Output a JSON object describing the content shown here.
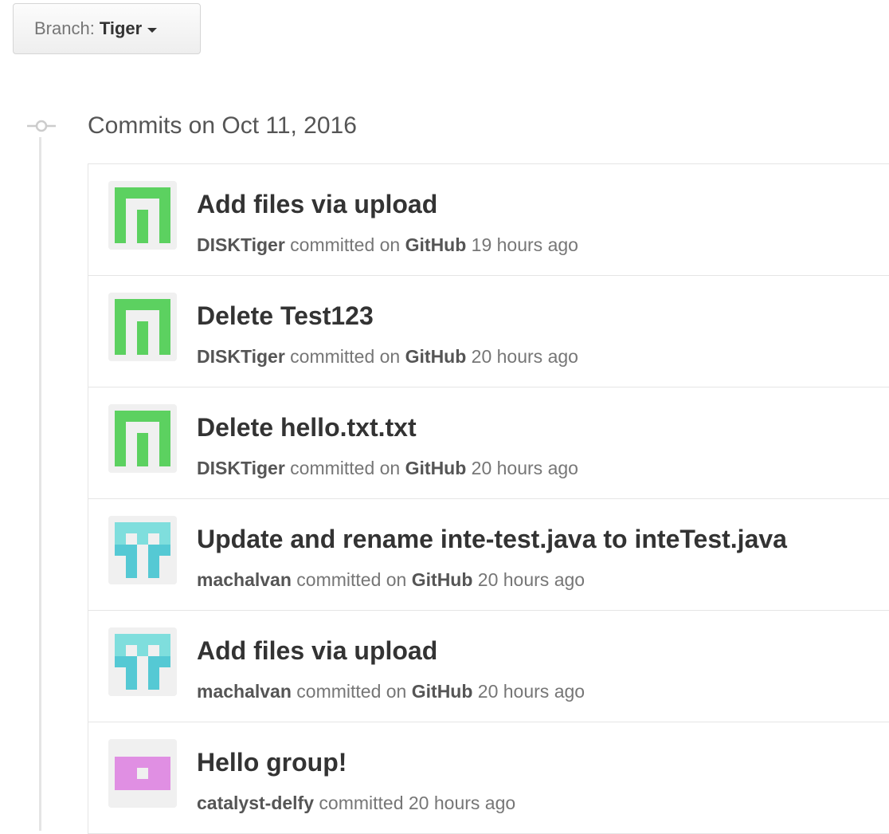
{
  "branch": {
    "label": "Branch:",
    "name": "Tiger"
  },
  "group": {
    "title": "Commits on Oct 11, 2016"
  },
  "commits": [
    {
      "message": "Add files via upload",
      "author": "DISKTiger",
      "verb": "committed on",
      "platform": "GitHub",
      "time": "19 hours ago",
      "avatar": "green-m"
    },
    {
      "message": "Delete Test123",
      "author": "DISKTiger",
      "verb": "committed on",
      "platform": "GitHub",
      "time": "20 hours ago",
      "avatar": "green-m"
    },
    {
      "message": "Delete hello.txt.txt",
      "author": "DISKTiger",
      "verb": "committed on",
      "platform": "GitHub",
      "time": "20 hours ago",
      "avatar": "green-m"
    },
    {
      "message": "Update and rename inte-test.java to inteTest.java",
      "author": "machalvan",
      "verb": "committed on",
      "platform": "GitHub",
      "time": "20 hours ago",
      "avatar": "cyan"
    },
    {
      "message": "Add files via upload",
      "author": "machalvan",
      "verb": "committed on",
      "platform": "GitHub",
      "time": "20 hours ago",
      "avatar": "cyan"
    },
    {
      "message": "Hello group!",
      "author": "catalyst-delfy",
      "verb": "committed",
      "platform": "",
      "time": "20 hours ago",
      "avatar": "pink"
    }
  ],
  "colors": {
    "avatar_green": "#5cd160",
    "avatar_cyan": "#7fdedd",
    "avatar_pink": "#e08fe3"
  }
}
